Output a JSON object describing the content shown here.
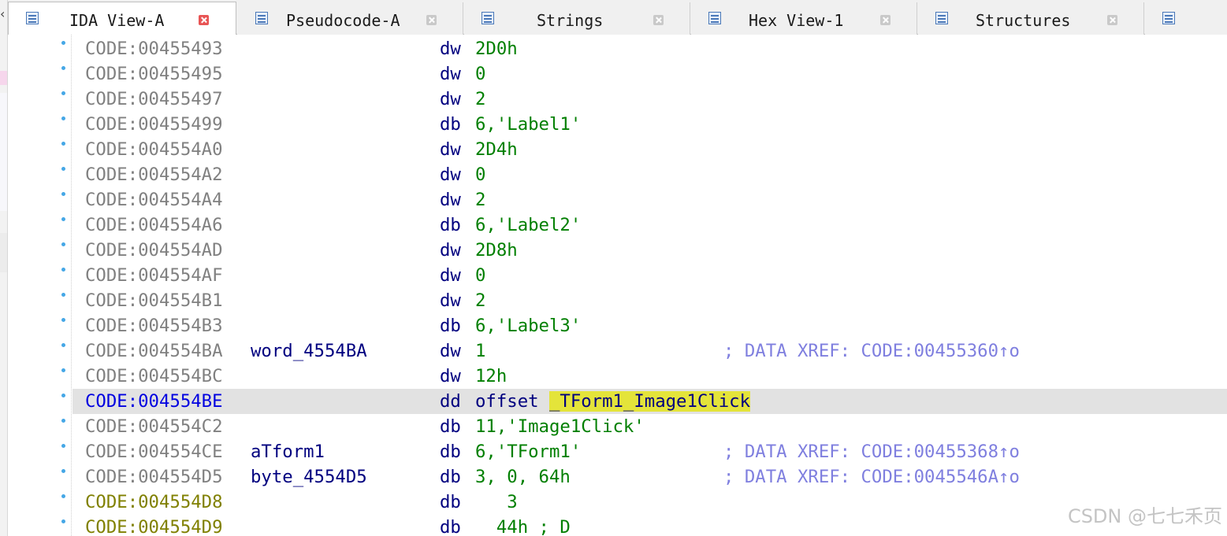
{
  "tabs": [
    {
      "label": "IDA View-A",
      "active": true,
      "icon": "listing-icon"
    },
    {
      "label": "Pseudocode-A",
      "active": false,
      "icon": "pseudocode-icon"
    },
    {
      "label": "Strings",
      "active": false,
      "icon": "strings-icon"
    },
    {
      "label": "Hex View-1",
      "active": false,
      "icon": "hex-icon"
    },
    {
      "label": "Structures",
      "active": false,
      "icon": "structures-icon"
    }
  ],
  "listing": {
    "rows": [
      {
        "addr": "CODE:00455493",
        "name": "",
        "mnem": "dw",
        "ops": "2D0h",
        "cmt": ""
      },
      {
        "addr": "CODE:00455495",
        "name": "",
        "mnem": "dw",
        "ops": "0",
        "cmt": ""
      },
      {
        "addr": "CODE:00455497",
        "name": "",
        "mnem": "dw",
        "ops": "2",
        "cmt": ""
      },
      {
        "addr": "CODE:00455499",
        "name": "",
        "mnem": "db",
        "ops": "6,'Label1'",
        "cmt": ""
      },
      {
        "addr": "CODE:004554A0",
        "name": "",
        "mnem": "dw",
        "ops": "2D4h",
        "cmt": ""
      },
      {
        "addr": "CODE:004554A2",
        "name": "",
        "mnem": "dw",
        "ops": "0",
        "cmt": ""
      },
      {
        "addr": "CODE:004554A4",
        "name": "",
        "mnem": "dw",
        "ops": "2",
        "cmt": ""
      },
      {
        "addr": "CODE:004554A6",
        "name": "",
        "mnem": "db",
        "ops": "6,'Label2'",
        "cmt": ""
      },
      {
        "addr": "CODE:004554AD",
        "name": "",
        "mnem": "dw",
        "ops": "2D8h",
        "cmt": ""
      },
      {
        "addr": "CODE:004554AF",
        "name": "",
        "mnem": "dw",
        "ops": "0",
        "cmt": ""
      },
      {
        "addr": "CODE:004554B1",
        "name": "",
        "mnem": "dw",
        "ops": "2",
        "cmt": ""
      },
      {
        "addr": "CODE:004554B3",
        "name": "",
        "mnem": "db",
        "ops": "6,'Label3'",
        "cmt": ""
      },
      {
        "addr": "CODE:004554BA",
        "name": "word_4554BA",
        "mnem": "dw",
        "ops": "1",
        "cmt": "; DATA XREF: CODE:00455360↑o"
      },
      {
        "addr": "CODE:004554BC",
        "name": "",
        "mnem": "dw",
        "ops": "12h",
        "cmt": ""
      },
      {
        "addr": "CODE:004554BE",
        "name": "",
        "mnem": "dd",
        "ops": "offset ",
        "ops_highlight": "_TForm1_Image1Click",
        "cmt": "",
        "selected": true
      },
      {
        "addr": "CODE:004554C2",
        "name": "",
        "mnem": "db",
        "ops": "11,'Image1Click'",
        "cmt": ""
      },
      {
        "addr": "CODE:004554CE",
        "name": "aTform1",
        "mnem": "db",
        "ops": "6,'TForm1'",
        "cmt": "; DATA XREF: CODE:00455368↑o"
      },
      {
        "addr": "CODE:004554D5",
        "name": "byte_4554D5",
        "mnem": "db",
        "ops": "3, 0, 64h",
        "cmt": "; DATA XREF: CODE:0045546A↑o"
      },
      {
        "addr": "CODE:004554D8",
        "name": "",
        "mnem": "db",
        "ops": "   3",
        "cmt": "",
        "olive": true
      },
      {
        "addr": "CODE:004554D9",
        "name": "",
        "mnem": "db",
        "ops": "  44h ; D",
        "cmt": "",
        "olive": true
      }
    ]
  },
  "watermark": "CSDN @七七禾页",
  "colors": {
    "address": "#808080",
    "address_selected": "#0000e0",
    "address_unexplored": "#808000",
    "mnemonic": "#00007f",
    "operand": "#007f00",
    "comment": "#7f7fdf",
    "highlight": "#e4e43a",
    "selection": "#e2e2e2"
  }
}
